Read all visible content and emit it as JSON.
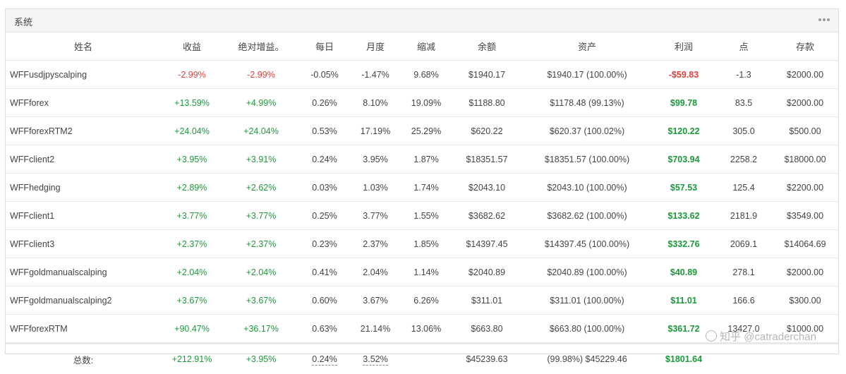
{
  "panel": {
    "title": "系统"
  },
  "table": {
    "headers": [
      "姓名",
      "收益",
      "绝对增益。",
      "每日",
      "月度",
      "缩减",
      "余额",
      "资产",
      "利润",
      "点",
      "存款"
    ],
    "rows": [
      {
        "name": "WFFusdjpyscalping",
        "gain": "-2.99%",
        "abs_gain": "-2.99%",
        "daily": "-0.05%",
        "monthly": "-1.47%",
        "drawdown": "9.68%",
        "balance": "$1940.17",
        "equity": "$1940.17 (100.00%)",
        "profit": "-$59.83",
        "pips": "-1.3",
        "deposit": "$2000.00",
        "sign": "neg"
      },
      {
        "name": "WFFforex",
        "gain": "+13.59%",
        "abs_gain": "+4.99%",
        "daily": "0.26%",
        "monthly": "8.10%",
        "drawdown": "19.09%",
        "balance": "$1188.80",
        "equity": "$1178.48 (99.13%)",
        "profit": "$99.78",
        "pips": "83.5",
        "deposit": "$2000.00",
        "sign": "pos"
      },
      {
        "name": "WFFforexRTM2",
        "gain": "+24.04%",
        "abs_gain": "+24.04%",
        "daily": "0.53%",
        "monthly": "17.19%",
        "drawdown": "25.29%",
        "balance": "$620.22",
        "equity": "$620.37 (100.02%)",
        "profit": "$120.22",
        "pips": "305.0",
        "deposit": "$500.00",
        "sign": "pos"
      },
      {
        "name": "WFFclient2",
        "gain": "+3.95%",
        "abs_gain": "+3.91%",
        "daily": "0.24%",
        "monthly": "3.95%",
        "drawdown": "1.87%",
        "balance": "$18351.57",
        "equity": "$18351.57 (100.00%)",
        "profit": "$703.94",
        "pips": "2258.2",
        "deposit": "$18000.00",
        "sign": "pos"
      },
      {
        "name": "WFFhedging",
        "gain": "+2.89%",
        "abs_gain": "+2.62%",
        "daily": "0.03%",
        "monthly": "1.03%",
        "drawdown": "1.74%",
        "balance": "$2043.10",
        "equity": "$2043.10 (100.00%)",
        "profit": "$57.53",
        "pips": "125.4",
        "deposit": "$2200.00",
        "sign": "pos"
      },
      {
        "name": "WFFclient1",
        "gain": "+3.77%",
        "abs_gain": "+3.77%",
        "daily": "0.25%",
        "monthly": "3.77%",
        "drawdown": "1.55%",
        "balance": "$3682.62",
        "equity": "$3682.62 (100.00%)",
        "profit": "$133.62",
        "pips": "2181.9",
        "deposit": "$3549.00",
        "sign": "pos"
      },
      {
        "name": "WFFclient3",
        "gain": "+2.37%",
        "abs_gain": "+2.37%",
        "daily": "0.23%",
        "monthly": "2.37%",
        "drawdown": "1.85%",
        "balance": "$14397.45",
        "equity": "$14397.45 (100.00%)",
        "profit": "$332.76",
        "pips": "2069.1",
        "deposit": "$14064.69",
        "sign": "pos"
      },
      {
        "name": "WFFgoldmanualscalping",
        "gain": "+2.04%",
        "abs_gain": "+2.04%",
        "daily": "0.41%",
        "monthly": "2.04%",
        "drawdown": "1.14%",
        "balance": "$2040.89",
        "equity": "$2040.89 (100.00%)",
        "profit": "$40.89",
        "pips": "278.1",
        "deposit": "$2000.00",
        "sign": "pos"
      },
      {
        "name": "WFFgoldmanualscalping2",
        "gain": "+3.67%",
        "abs_gain": "+3.67%",
        "daily": "0.60%",
        "monthly": "3.67%",
        "drawdown": "6.26%",
        "balance": "$311.01",
        "equity": "$311.01 (100.00%)",
        "profit": "$11.01",
        "pips": "166.6",
        "deposit": "$300.00",
        "sign": "pos"
      },
      {
        "name": "WFFforexRTM",
        "gain": "+90.47%",
        "abs_gain": "+36.17%",
        "daily": "0.63%",
        "monthly": "21.14%",
        "drawdown": "13.06%",
        "balance": "$663.80",
        "equity": "$663.80 (100.00%)",
        "profit": "$361.72",
        "pips": "13427.0",
        "deposit": "$1000.00",
        "sign": "pos"
      }
    ],
    "total": {
      "label": "总数:",
      "gain": "+212.91%",
      "abs_gain": "+3.95%",
      "daily": "0.24%",
      "monthly": "3.52%",
      "balance": "$45239.63",
      "equity": "(99.98%) $45229.46",
      "profit": "$1801.64"
    }
  },
  "watermark": "知乎 @catraderchan",
  "colors": {
    "positive": "#1a9a3a",
    "negative": "#e0403a",
    "header_bg": "#f5f5f5"
  },
  "icons": {
    "panel_menu": "more-dots-icon"
  }
}
